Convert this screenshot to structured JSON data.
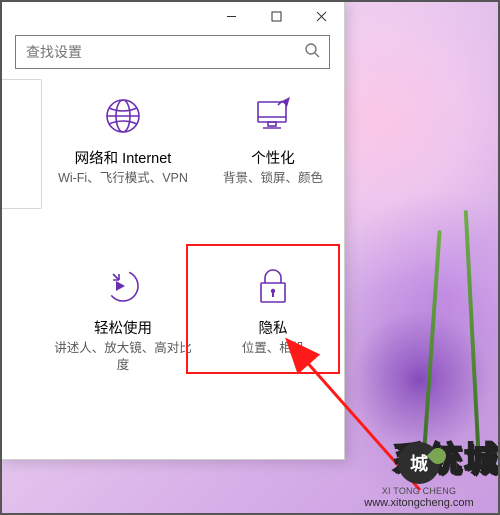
{
  "window": {
    "search_placeholder": "查找设置",
    "buttons": {
      "minimize": "minimize",
      "maximize": "maximize",
      "close": "close"
    }
  },
  "tiles": {
    "network": {
      "title": "网络和 Internet",
      "subtitle": "Wi-Fi、飞行模式、VPN"
    },
    "personalization": {
      "title": "个性化",
      "subtitle": "背景、锁屏、颜色"
    },
    "ease": {
      "title": "轻松使用",
      "subtitle": "讲述人、放大镜、高对比度"
    },
    "privacy": {
      "title": "隐私",
      "subtitle": "位置、相机"
    }
  },
  "accent_color": "#6b2fb3",
  "highlight_color": "#ff1a1a",
  "watermark": {
    "brand_cn": "系统城",
    "brand_en": "XI TONG CHENG",
    "site": "www.xitongcheng.com"
  }
}
